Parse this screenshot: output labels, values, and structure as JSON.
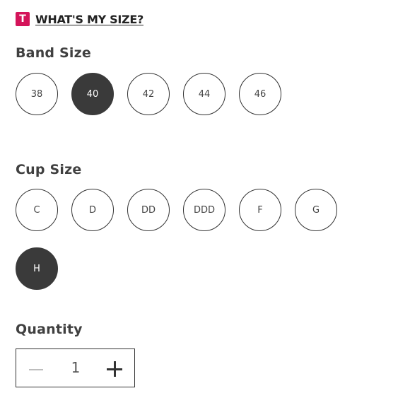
{
  "size_guide": {
    "badge": "T",
    "link_label": "WHAT'S MY SIZE?"
  },
  "band_size": {
    "title": "Band Size",
    "options": [
      "38",
      "40",
      "42",
      "44",
      "46"
    ],
    "selected": "40"
  },
  "cup_size": {
    "title": "Cup Size",
    "options": [
      "C",
      "D",
      "DD",
      "DDD",
      "F",
      "G",
      "H"
    ],
    "selected": "H"
  },
  "quantity": {
    "title": "Quantity",
    "value": "1"
  },
  "colors": {
    "brand": "#d4145a",
    "selected": "#3a3a3a"
  }
}
